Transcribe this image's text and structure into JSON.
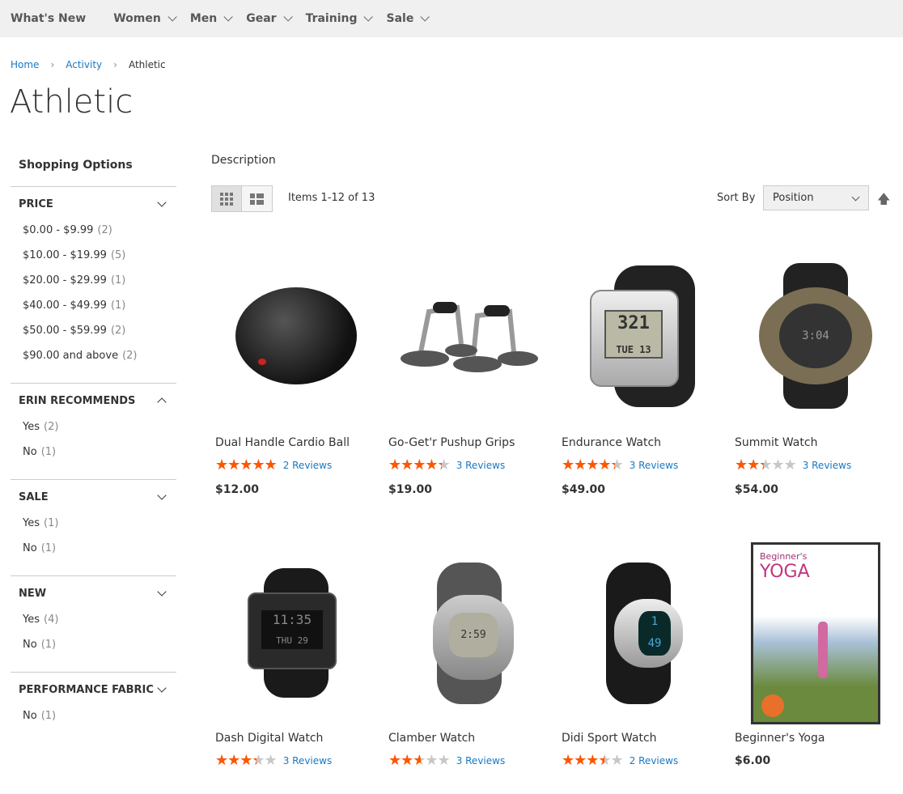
{
  "nav": [
    "What's New",
    "Women",
    "Men",
    "Gear",
    "Training",
    "Sale"
  ],
  "breadcrumb": [
    "Home",
    "Activity",
    "Athletic"
  ],
  "title": "Athletic",
  "sidebar": {
    "title": "Shopping Options",
    "filters": [
      {
        "name": "Price",
        "expanded": true,
        "items": [
          {
            "label": "$0.00 - $9.99",
            "count": "(2)"
          },
          {
            "label": "$10.00 - $19.99",
            "count": "(5)"
          },
          {
            "label": "$20.00 - $29.99",
            "count": "(1)"
          },
          {
            "label": "$40.00 - $49.99",
            "count": "(1)"
          },
          {
            "label": "$50.00 - $59.99",
            "count": "(2)"
          },
          {
            "label": "$90.00 and above",
            "count": "(2)"
          }
        ]
      },
      {
        "name": "Erin Recommends",
        "expanded": true,
        "items": [
          {
            "label": "Yes",
            "count": "(2)"
          },
          {
            "label": "No",
            "count": "(1)"
          }
        ]
      },
      {
        "name": "Sale",
        "expanded": true,
        "items": [
          {
            "label": "Yes",
            "count": "(1)"
          },
          {
            "label": "No",
            "count": "(1)"
          }
        ]
      },
      {
        "name": "New",
        "expanded": true,
        "items": [
          {
            "label": "Yes",
            "count": "(4)"
          },
          {
            "label": "No",
            "count": "(1)"
          }
        ]
      },
      {
        "name": "Performance Fabric",
        "expanded": true,
        "items": [
          {
            "label": "No",
            "count": "(1)"
          }
        ]
      }
    ]
  },
  "description": "Description",
  "toolbar": {
    "amount": "Items 1-12 of 13",
    "sort_label": "Sort By",
    "sort_value": "Position"
  },
  "products": [
    {
      "name": "Dual Handle Cardio Ball",
      "rating_pct": 100,
      "reviews": "2  Reviews",
      "price": "$12.00",
      "img": "ball"
    },
    {
      "name": "Go-Get'r Pushup Grips",
      "rating_pct": 87,
      "reviews": "3  Reviews",
      "price": "$19.00",
      "img": "grips"
    },
    {
      "name": "Endurance Watch",
      "rating_pct": 87,
      "reviews": "3  Reviews",
      "price": "$49.00",
      "img": "watch-silver"
    },
    {
      "name": "Summit Watch",
      "rating_pct": 47,
      "reviews": "3  Reviews",
      "price": "$54.00",
      "img": "watch-round"
    },
    {
      "name": "Dash Digital Watch",
      "rating_pct": 67,
      "reviews": "3  Reviews",
      "price": "",
      "img": "watch-black"
    },
    {
      "name": "Clamber Watch",
      "rating_pct": 53,
      "reviews": "3  Reviews",
      "price": "",
      "img": "watch-grey"
    },
    {
      "name": "Didi Sport Watch",
      "rating_pct": 70,
      "reviews": "2  Reviews",
      "price": "",
      "img": "watch-didi"
    },
    {
      "name": "Beginner's Yoga",
      "rating_pct": null,
      "reviews": "",
      "price": "$6.00",
      "img": "dvd",
      "dvd_text": "Beginner's YOGA"
    }
  ],
  "colors": {
    "star": "#ff5501",
    "link": "#1979c3",
    "nav_bg": "#f0f0f0"
  }
}
